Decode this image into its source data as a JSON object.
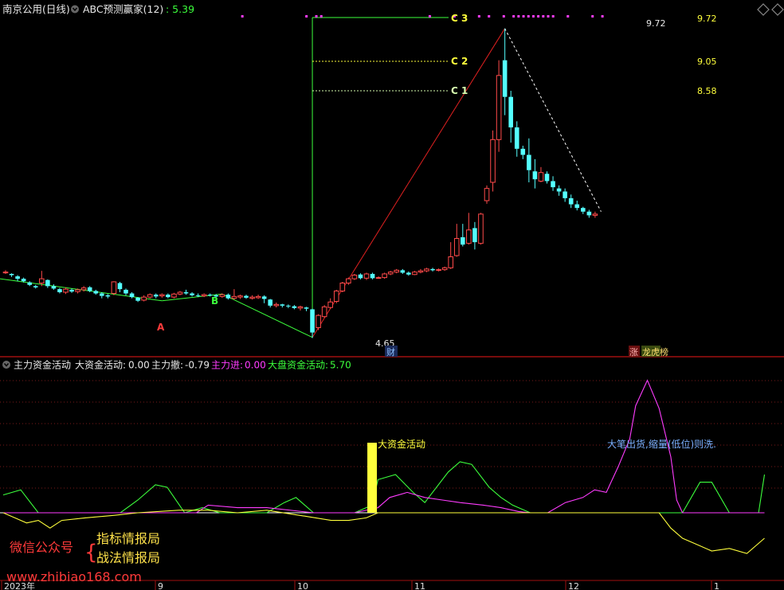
{
  "colors": {
    "up": "#ff4a4a",
    "down": "#54ffff",
    "bg": "#000000",
    "grid": "#7a1a1a",
    "green": "#3cff3c",
    "magenta": "#ff3cff",
    "yellow": "#ffff3c",
    "white": "#dddddd",
    "sep": "#a01010"
  },
  "header": {
    "stock": "南京公用(日线)",
    "indicator": "ABC预测赢家(12)",
    "indicator_value": ": 5.39"
  },
  "main_panel": {
    "level_labels": [
      {
        "text": "C 3",
        "value": "9.72"
      },
      {
        "text": "C 2",
        "value": "9.05"
      },
      {
        "text": "C 1",
        "value": "8.58"
      }
    ],
    "peak_label": "9.72",
    "low_label": "4.65",
    "point_a": "A",
    "point_b": "B",
    "badge_cai": "财",
    "badge_zhang": "涨",
    "badge_longhu": "龙虎榜"
  },
  "sub_panel": {
    "title": "主力资金活动",
    "items": [
      {
        "label": "大资金活动:",
        "value": "0.00"
      },
      {
        "label": "主力撤:",
        "value": "-0.79"
      },
      {
        "label": "主力进:",
        "value": "0.00"
      },
      {
        "label": "大盘资金活动:",
        "value": "5.70"
      }
    ],
    "annotation_big": "大资金活动",
    "annotation_sell": "大笔出货,缩量(低位)则洗."
  },
  "watermark": {
    "wechat": "微信公众号",
    "brand1": "指标情报局",
    "brand2": "战法情报局",
    "url": "www.zhibiao168.com"
  },
  "x_axis": {
    "labels": [
      "2023年",
      "9",
      "10",
      "11",
      "12",
      "1"
    ]
  },
  "chart_data": [
    {
      "type": "candlestick",
      "title": "南京公用(日线)",
      "ylim": [
        4.5,
        9.9
      ],
      "candles": [
        [
          5.72,
          5.73,
          5.7,
          5.76
        ],
        [
          5.7,
          5.68,
          5.65,
          5.71
        ],
        [
          5.66,
          5.62,
          5.58,
          5.68
        ],
        [
          5.62,
          5.58,
          5.56,
          5.64
        ],
        [
          5.56,
          5.52,
          5.5,
          5.58
        ],
        [
          5.5,
          5.48,
          5.46,
          5.52
        ],
        [
          5.55,
          5.62,
          5.5,
          5.75
        ],
        [
          5.6,
          5.5,
          5.47,
          5.61
        ],
        [
          5.5,
          5.46,
          5.44,
          5.53
        ],
        [
          5.45,
          5.4,
          5.38,
          5.47
        ],
        [
          5.4,
          5.45,
          5.37,
          5.48
        ],
        [
          5.44,
          5.41,
          5.39,
          5.46
        ],
        [
          5.41,
          5.44,
          5.38,
          5.46
        ],
        [
          5.44,
          5.47,
          5.41,
          5.5
        ],
        [
          5.48,
          5.42,
          5.4,
          5.5
        ],
        [
          5.42,
          5.38,
          5.36,
          5.44
        ],
        [
          5.38,
          5.34,
          5.3,
          5.4
        ],
        [
          5.35,
          5.33,
          5.3,
          5.37
        ],
        [
          5.38,
          5.57,
          5.35,
          5.58
        ],
        [
          5.55,
          5.45,
          5.4,
          5.57
        ],
        [
          5.44,
          5.38,
          5.35,
          5.46
        ],
        [
          5.38,
          5.32,
          5.3,
          5.4
        ],
        [
          5.31,
          5.26,
          5.24,
          5.32
        ],
        [
          5.27,
          5.32,
          5.25,
          5.35
        ],
        [
          5.32,
          5.36,
          5.3,
          5.38
        ],
        [
          5.36,
          5.33,
          5.3,
          5.38
        ],
        [
          5.34,
          5.36,
          5.31,
          5.38
        ],
        [
          5.36,
          5.32,
          5.3,
          5.38
        ],
        [
          5.32,
          5.37,
          5.3,
          5.39
        ],
        [
          5.37,
          5.4,
          5.35,
          5.42
        ],
        [
          5.4,
          5.38,
          5.36,
          5.44
        ],
        [
          5.38,
          5.35,
          5.33,
          5.4
        ],
        [
          5.35,
          5.34,
          5.32,
          5.38
        ],
        [
          5.34,
          5.36,
          5.32,
          5.38
        ],
        [
          5.36,
          5.35,
          5.33,
          5.38
        ],
        [
          5.35,
          5.33,
          5.31,
          5.37
        ],
        [
          5.33,
          5.36,
          5.31,
          5.38
        ],
        [
          5.36,
          5.3,
          5.28,
          5.38
        ],
        [
          5.3,
          5.33,
          5.28,
          5.45
        ],
        [
          5.32,
          5.34,
          5.29,
          5.36
        ],
        [
          5.34,
          5.31,
          5.29,
          5.36
        ],
        [
          5.3,
          5.32,
          5.28,
          5.35
        ],
        [
          5.31,
          5.33,
          5.29,
          5.36
        ],
        [
          5.33,
          5.29,
          5.22,
          5.35
        ],
        [
          5.28,
          5.18,
          5.15,
          5.29
        ],
        [
          5.18,
          5.2,
          5.15,
          5.23
        ],
        [
          5.2,
          5.18,
          5.15,
          5.21
        ],
        [
          5.18,
          5.17,
          5.14,
          5.2
        ],
        [
          5.17,
          5.14,
          5.12,
          5.19
        ],
        [
          5.14,
          5.16,
          5.1,
          5.18
        ],
        [
          5.15,
          5.13,
          5.09,
          5.16
        ],
        [
          5.12,
          4.74,
          4.65,
          5.13
        ],
        [
          4.82,
          5.02,
          4.78,
          5.04
        ],
        [
          5.0,
          5.16,
          4.98,
          5.19
        ],
        [
          5.15,
          5.24,
          5.13,
          5.3
        ],
        [
          5.25,
          5.42,
          5.22,
          5.44
        ],
        [
          5.42,
          5.55,
          5.4,
          5.57
        ],
        [
          5.55,
          5.62,
          5.52,
          5.64
        ],
        [
          5.62,
          5.68,
          5.6,
          5.7
        ],
        [
          5.69,
          5.63,
          5.61,
          5.71
        ],
        [
          5.63,
          5.7,
          5.6,
          5.72
        ],
        [
          5.7,
          5.63,
          5.61,
          5.72
        ],
        [
          5.64,
          5.64,
          5.62,
          5.66
        ],
        [
          5.64,
          5.7,
          5.62,
          5.72
        ],
        [
          5.7,
          5.73,
          5.68,
          5.75
        ],
        [
          5.73,
          5.76,
          5.71,
          5.78
        ],
        [
          5.76,
          5.72,
          5.7,
          5.78
        ],
        [
          5.72,
          5.69,
          5.67,
          5.74
        ],
        [
          5.69,
          5.73,
          5.68,
          5.75
        ],
        [
          5.73,
          5.75,
          5.71,
          5.78
        ],
        [
          5.75,
          5.78,
          5.73,
          5.8
        ],
        [
          5.78,
          5.76,
          5.74,
          5.8
        ],
        [
          5.76,
          5.77,
          5.74,
          5.79
        ],
        [
          5.77,
          5.8,
          5.75,
          5.82
        ],
        [
          5.8,
          5.98,
          5.78,
          6.22
        ],
        [
          6.0,
          6.28,
          5.98,
          6.52
        ],
        [
          6.3,
          6.18,
          6.15,
          6.52
        ],
        [
          6.2,
          6.42,
          6.18,
          6.7
        ],
        [
          6.45,
          6.22,
          6.1,
          6.55
        ],
        [
          6.2,
          6.68,
          6.18,
          6.7
        ],
        [
          6.9,
          7.1,
          6.85,
          7.15
        ],
        [
          7.2,
          7.9,
          7.05,
          8.05
        ],
        [
          7.9,
          8.95,
          7.7,
          9.2
        ],
        [
          9.2,
          8.6,
          8.3,
          9.72
        ],
        [
          8.6,
          8.1,
          7.85,
          8.7
        ],
        [
          8.1,
          7.75,
          7.62,
          8.2
        ],
        [
          7.75,
          7.65,
          7.58,
          7.8
        ],
        [
          7.65,
          7.4,
          7.2,
          7.92
        ],
        [
          7.38,
          7.25,
          7.1,
          7.58
        ],
        [
          7.22,
          7.36,
          7.2,
          7.45
        ],
        [
          7.34,
          7.22,
          7.18,
          7.38
        ],
        [
          7.22,
          7.12,
          7.06,
          7.3
        ],
        [
          7.1,
          7.05,
          6.98,
          7.15
        ],
        [
          7.05,
          6.94,
          6.88,
          7.1
        ],
        [
          6.94,
          6.84,
          6.78,
          7.0
        ],
        [
          6.84,
          6.78,
          6.74,
          6.9
        ],
        [
          6.78,
          6.72,
          6.68,
          6.8
        ],
        [
          6.72,
          6.66,
          6.62,
          6.75
        ],
        [
          6.66,
          6.68,
          6.62,
          6.72
        ]
      ],
      "levels": [
        {
          "name": "C 1",
          "value": 8.58
        },
        {
          "name": "C 2",
          "value": 9.05
        },
        {
          "name": "C 3",
          "value": 9.72
        }
      ],
      "annotations": [
        {
          "text": "4.65",
          "index": 51,
          "value": 4.65
        },
        {
          "text": "9.72",
          "index": 83,
          "value": 9.72
        }
      ]
    },
    {
      "type": "line",
      "title": "主力资金活动",
      "ylim": [
        -1.0,
        6.2
      ],
      "series": [
        {
          "name": "大盘资金活动",
          "color": "green",
          "points": [
            [
              0,
              0.7
            ],
            [
              3,
              0.9
            ],
            [
              6,
              0
            ],
            [
              20,
              0
            ],
            [
              23,
              0.5
            ],
            [
              26,
              1.1
            ],
            [
              28,
              1.0
            ],
            [
              31,
              0
            ],
            [
              34,
              0.2
            ],
            [
              37,
              0
            ],
            [
              45,
              0
            ],
            [
              48,
              0.4
            ],
            [
              50,
              0.6
            ],
            [
              53,
              0
            ],
            [
              60,
              0
            ],
            [
              63,
              0.3
            ],
            [
              64,
              1.3
            ],
            [
              67,
              1.5
            ],
            [
              70,
              0.8
            ],
            [
              72,
              0.4
            ],
            [
              73,
              0.7
            ],
            [
              76,
              1.6
            ],
            [
              78,
              2.0
            ],
            [
              80,
              1.9
            ],
            [
              83,
              1.0
            ],
            [
              85,
              0.6
            ],
            [
              87,
              0.3
            ],
            [
              88,
              0.2
            ],
            [
              90,
              0
            ],
            [
              116,
              0
            ],
            [
              119,
              1.2
            ],
            [
              121,
              1.2
            ],
            [
              124,
              0
            ],
            [
              129,
              0
            ],
            [
              130,
              1.5
            ]
          ]
        },
        {
          "name": "主力进",
          "color": "magenta",
          "points": [
            [
              0,
              0
            ],
            [
              33,
              0
            ],
            [
              35,
              0.3
            ],
            [
              40,
              0.2
            ],
            [
              45,
              0.2
            ],
            [
              53,
              0
            ],
            [
              60,
              0
            ],
            [
              64,
              0.2
            ],
            [
              66,
              0.6
            ],
            [
              69,
              0.8
            ],
            [
              72,
              0.6
            ],
            [
              75,
              0.5
            ],
            [
              78,
              0.4
            ],
            [
              82,
              0.3
            ],
            [
              85,
              0.2
            ],
            [
              88,
              0.05
            ],
            [
              90,
              0
            ],
            [
              93,
              0
            ],
            [
              96,
              0.4
            ],
            [
              99,
              0.6
            ],
            [
              101,
              0.9
            ],
            [
              103,
              0.8
            ],
            [
              105,
              1.8
            ],
            [
              107,
              2.9
            ],
            [
              108,
              4.2
            ],
            [
              110,
              5.2
            ],
            [
              112,
              4.1
            ],
            [
              114,
              2.2
            ],
            [
              115,
              0.5
            ],
            [
              116,
              0
            ],
            [
              130,
              0
            ]
          ]
        },
        {
          "name": "主力撤",
          "color": "yellow",
          "points": [
            [
              0,
              0
            ],
            [
              2,
              -0.2
            ],
            [
              4,
              -0.4
            ],
            [
              6,
              -0.3
            ],
            [
              8,
              -0.6
            ],
            [
              10,
              -0.3
            ],
            [
              14,
              -0.2
            ],
            [
              19,
              -0.1
            ],
            [
              23,
              0
            ],
            [
              30,
              0.1
            ],
            [
              35,
              0.1
            ],
            [
              40,
              0
            ],
            [
              45,
              0.1
            ],
            [
              52,
              -0.15
            ],
            [
              56,
              -0.3
            ],
            [
              59,
              -0.3
            ],
            [
              62,
              -0.2
            ],
            [
              64,
              0
            ],
            [
              112,
              0
            ],
            [
              113,
              -0.3
            ],
            [
              114,
              -0.6
            ],
            [
              116,
              -1.0
            ],
            [
              118,
              -1.2
            ],
            [
              121,
              -1.5
            ],
            [
              124,
              -1.4
            ],
            [
              127,
              -1.6
            ],
            [
              130,
              -1.0
            ]
          ]
        },
        {
          "name": "大资金活动",
          "color": "yellow",
          "type": "bar",
          "points": [
            [
              63,
              2.5
            ]
          ]
        }
      ]
    }
  ]
}
